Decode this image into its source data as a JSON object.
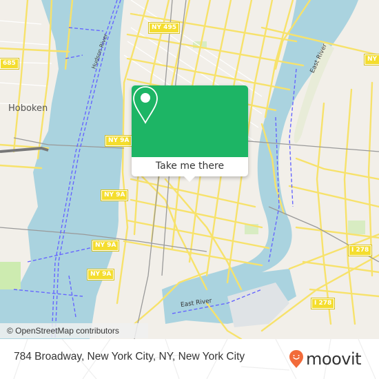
{
  "map": {
    "labels": {
      "hoboken": "Hoboken",
      "east_river_upper": "East River",
      "east_river_lower": "East River",
      "hudson_river": "Hudson River"
    },
    "shields": {
      "ny495": "NY 495",
      "i685": "685",
      "ny9a_1": "NY 9A",
      "ny9a_2": "NY 9A",
      "ny9a_3": "NY 9A",
      "ny9a_4": "NY 9A",
      "ny_partial": "NY",
      "i278_1": "I 278",
      "i278_2": "I 278"
    },
    "attribution": "© OpenStreetMap contributors",
    "colors": {
      "water": "#aad3df",
      "land": "#f2efe9",
      "road": "#f7e26b",
      "ferry": "#6666ff",
      "rail": "#999999",
      "park": "#cdebb0"
    }
  },
  "popup": {
    "button_label": "Take me there",
    "color": "#1db565"
  },
  "footer": {
    "address": "784 Broadway, New York City, NY, New York City",
    "brand": "moovit",
    "brand_color": "#f26b3a"
  }
}
